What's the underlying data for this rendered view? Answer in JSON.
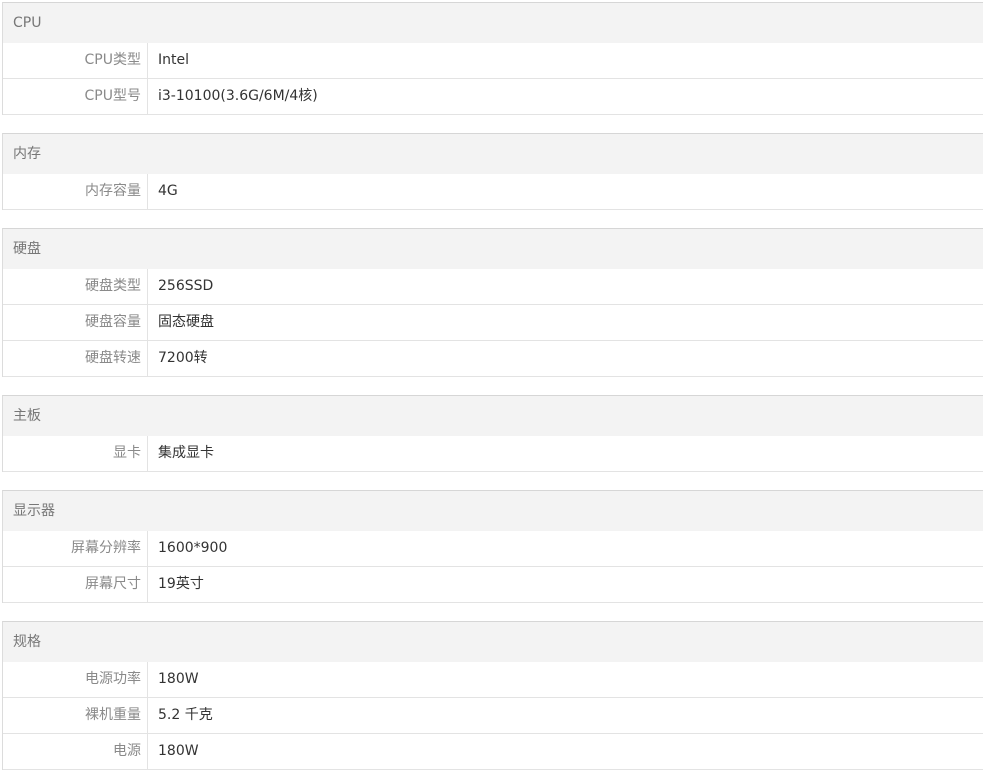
{
  "sections": [
    {
      "title": "CPU",
      "rows": [
        {
          "label": "CPU类型",
          "value": "Intel"
        },
        {
          "label": "CPU型号",
          "value": "i3-10100(3.6G/6M/4核)"
        }
      ]
    },
    {
      "title": "内存",
      "rows": [
        {
          "label": "内存容量",
          "value": "4G"
        }
      ]
    },
    {
      "title": "硬盘",
      "rows": [
        {
          "label": "硬盘类型",
          "value": "256SSD"
        },
        {
          "label": "硬盘容量",
          "value": "固态硬盘"
        },
        {
          "label": "硬盘转速",
          "value": "7200转"
        }
      ]
    },
    {
      "title": "主板",
      "rows": [
        {
          "label": "显卡",
          "value": "集成显卡"
        }
      ]
    },
    {
      "title": "显示器",
      "rows": [
        {
          "label": "屏幕分辨率",
          "value": "1600*900"
        },
        {
          "label": "屏幕尺寸",
          "value": "19英寸"
        }
      ]
    },
    {
      "title": "规格",
      "rows": [
        {
          "label": "电源功率",
          "value": "180W"
        },
        {
          "label": "裸机重量",
          "value": "5.2 千克"
        },
        {
          "label": "电源",
          "value": "180W"
        }
      ]
    }
  ]
}
